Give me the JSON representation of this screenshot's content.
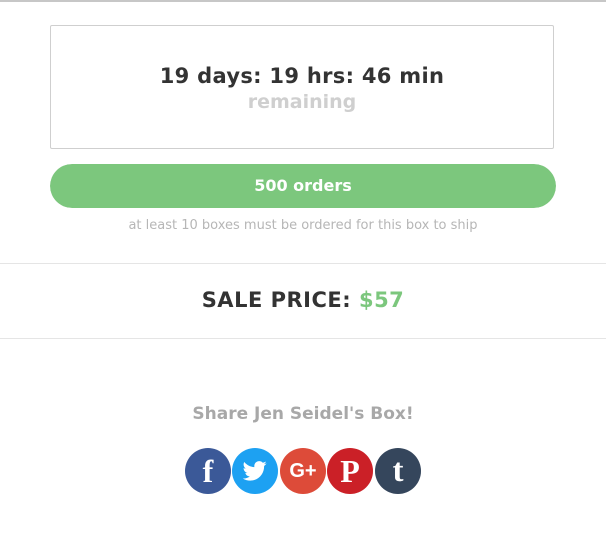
{
  "countdown": {
    "time": "19 days: 19 hrs: 46 min",
    "label": "remaining"
  },
  "orders": {
    "label": "500 orders",
    "progress_fraction": 1.0,
    "color": "#7cc77d"
  },
  "ship_note": "at least 10 boxes must be ordered for this box to ship",
  "sale": {
    "label": "SALE PRICE:",
    "amount": "$57",
    "accent_color": "#7cc77d"
  },
  "share": {
    "title": "Share Jen Seidel's Box!",
    "buttons": [
      {
        "icon": "facebook-icon",
        "glyph": "f",
        "color": "#3b5998"
      },
      {
        "icon": "twitter-icon",
        "glyph": "",
        "color": "#1da1f2"
      },
      {
        "icon": "google-plus-icon",
        "glyph": "G+",
        "color": "#dd4b39"
      },
      {
        "icon": "pinterest-icon",
        "glyph": "P",
        "color": "#cb2027"
      },
      {
        "icon": "tumblr-icon",
        "glyph": "t",
        "color": "#35465c"
      }
    ]
  }
}
